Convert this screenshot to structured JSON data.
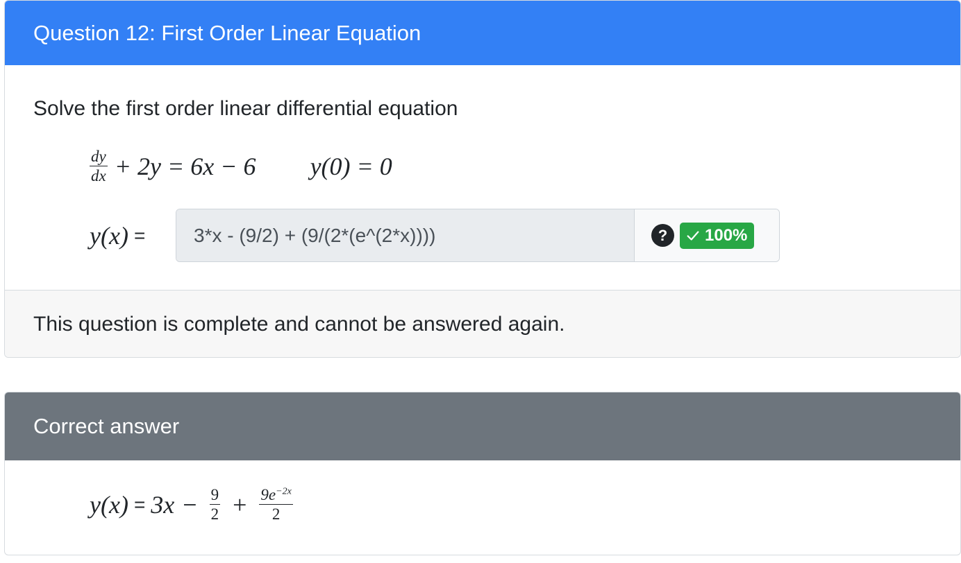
{
  "question": {
    "header_title": "Question 12: First Order Linear Equation",
    "prompt": "Solve the first order linear differential equation",
    "equation": {
      "dy_num": "dy",
      "dx_den": "dx",
      "main": "+ 2y = 6x − 6",
      "initial_condition": "y(0) = 0"
    },
    "answer_label": "y(x)",
    "answer_equals": "=",
    "answer_value": "3*x - (9/2) + (9/(2*(e^(2*x))))",
    "help_symbol": "?",
    "score_label": "100%",
    "footer_text": "This question is complete and cannot be answered again."
  },
  "correct_answer": {
    "header_title": "Correct answer",
    "lhs": "y(x)",
    "equals": "=",
    "term1": "3x",
    "minus": "−",
    "frac1_num": "9",
    "frac1_den": "2",
    "plus": "+",
    "frac2_num_base": "9e",
    "frac2_num_exp": "−2x",
    "frac2_den": "2"
  },
  "colors": {
    "primary_header": "#3380f5",
    "secondary_header": "#6d757d",
    "success_badge": "#28a745",
    "input_background": "#e9ecef"
  },
  "icons": [
    "help-icon",
    "check-icon"
  ]
}
